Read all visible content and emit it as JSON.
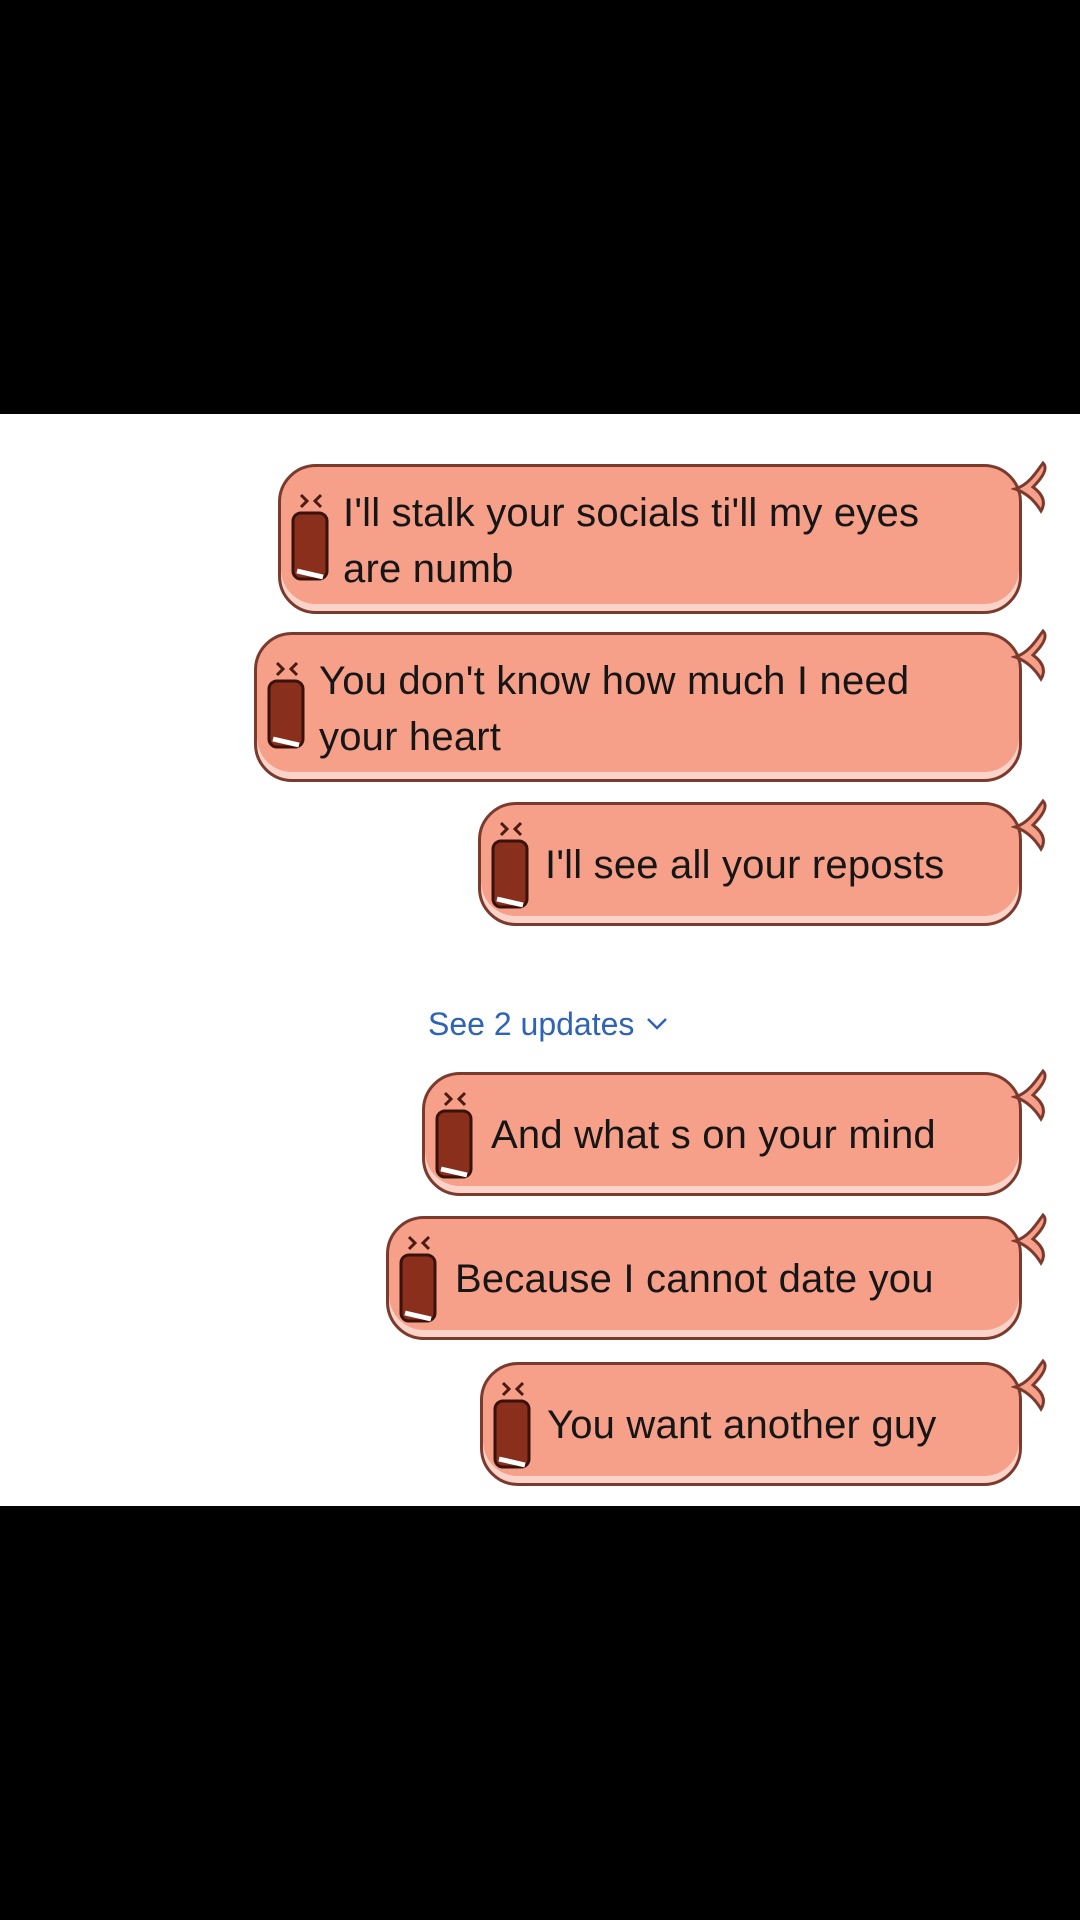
{
  "colors": {
    "bubble_fill": "#f6a08a",
    "bubble_border": "#7a3b2e",
    "link": "#2f63b5",
    "background": "#ffffff",
    "letterbox": "#000000"
  },
  "messages": [
    {
      "line1": "I'll stalk your socials ti'll my eyes",
      "line2": "are numb"
    },
    {
      "line1": "You don't know how much I need",
      "line2": "your heart"
    },
    {
      "line1": "I'll see all your reposts"
    },
    {
      "line1": "And what s on your mind"
    },
    {
      "line1": "Because I cannot date you"
    },
    {
      "line1": "You want another guy"
    }
  ],
  "updates": {
    "label": "See 2 updates",
    "icon": "chevron-down-icon"
  },
  "decorations": {
    "sticker_icon": "screaming-soda-can-icon",
    "bow_icon": "ribbon-bow-icon"
  }
}
